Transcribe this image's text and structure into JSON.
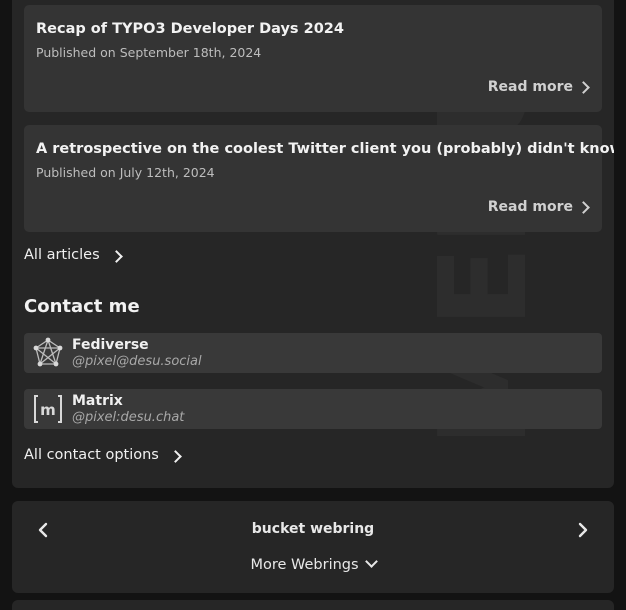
{
  "articles": [
    {
      "title": "Recap of TYPO3 Developer Days 2024",
      "date": "Published on September 18th, 2024",
      "read_more": "Read more"
    },
    {
      "title": "A retrospective on the coolest Twitter client you (probably) didn't know",
      "date": "Published on July 12th, 2024",
      "read_more": "Read more"
    }
  ],
  "all_articles_label": "All articles",
  "contact": {
    "heading": "Contact me",
    "items": [
      {
        "name": "Fediverse",
        "handle": "@pixel@desu.social",
        "icon": "fediverse-icon"
      },
      {
        "name": "Matrix",
        "handle": "@pixel:desu.chat",
        "icon": "matrix-icon"
      }
    ],
    "all_label": "All contact options"
  },
  "webring": {
    "title": "bucket webring",
    "more_label": "More Webrings",
    "prev_icon": "chevron-left-icon",
    "next_icon": "chevron-right-icon"
  },
  "colors": {
    "page_bg": "#131313",
    "panel_bg": "#262626",
    "card_bg": "#343434",
    "contact_card_bg": "#393939",
    "text": "#f2f2f2",
    "muted_text": "#bdbdbd"
  }
}
